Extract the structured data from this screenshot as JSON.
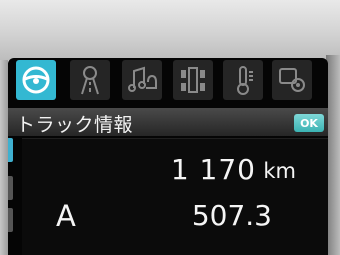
{
  "menu": {
    "icons": [
      {
        "name": "steering-wheel-icon",
        "active": true
      },
      {
        "name": "road-icon",
        "active": false
      },
      {
        "name": "music-icon",
        "active": false
      },
      {
        "name": "vehicle-chassis-icon",
        "active": false
      },
      {
        "name": "thermometer-icon",
        "active": false
      },
      {
        "name": "settings-icon",
        "active": false
      }
    ]
  },
  "title": {
    "text": "トラック情報",
    "ok_label": "OK"
  },
  "info": {
    "distance_value": "1 170",
    "distance_unit": "km",
    "trip_label": "A",
    "trip_value": "507.3"
  },
  "colors": {
    "accent": "#33b8d2",
    "background": "#050505",
    "text": "#f5f5f5"
  }
}
